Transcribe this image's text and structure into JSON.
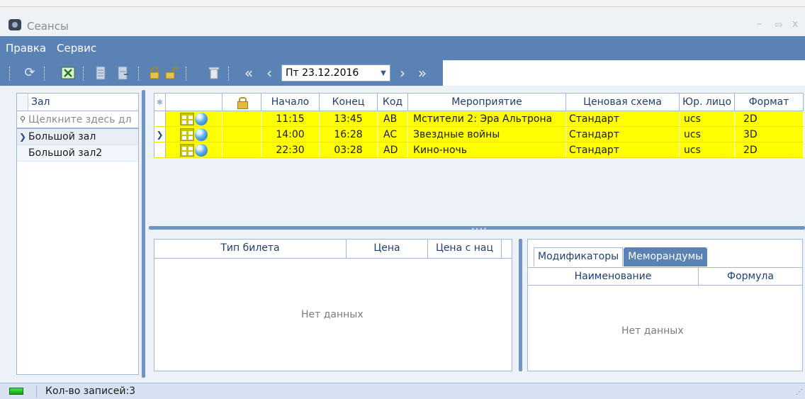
{
  "window": {
    "title": "Сеансы"
  },
  "menu": {
    "items": [
      "Правка",
      "Сервис"
    ]
  },
  "toolbar": {
    "date_value": "Пт 23.12.2016"
  },
  "halls": {
    "header": "Зал",
    "filter_placeholder": "Щелкните здесь дл",
    "rows": [
      {
        "label": "Большой зал",
        "selected": true
      },
      {
        "label": "Большой зал2",
        "selected": false
      }
    ]
  },
  "sessions": {
    "columns": [
      "",
      "",
      "",
      "Начало",
      "Конец",
      "Код",
      "Мероприятие",
      "Ценовая схема",
      "Юр. лицо",
      "Формат"
    ],
    "rows": [
      {
        "start": "11:15",
        "end": "13:45",
        "code": "AB",
        "event": "Мстители 2: Эра Альтрона",
        "price_scheme": "Стандарт",
        "entity": "ucs",
        "format": "2D",
        "current": false
      },
      {
        "start": "14:00",
        "end": "16:28",
        "code": "AC",
        "event": "Звездные войны",
        "price_scheme": "Стандарт",
        "entity": "ucs",
        "format": "3D",
        "current": true
      },
      {
        "start": "22:30",
        "end": "03:28",
        "code": "AD",
        "event": "Кино-ночь",
        "price_scheme": "Стандарт",
        "entity": "ucs",
        "format": "2D",
        "current": false
      }
    ],
    "row_color": "#ffff00"
  },
  "tickets": {
    "columns": [
      "Тип билета",
      "Цена",
      "Цена с нац"
    ],
    "empty_text": "Нет данных"
  },
  "modifiers": {
    "tabs": [
      "Модификаторы",
      "Меморандумы"
    ],
    "active_tab": 0,
    "columns": [
      "Наименование",
      "Формула"
    ],
    "empty_text": "Нет данных"
  },
  "status": {
    "records_text": "Кол-во записей:3"
  },
  "colors": {
    "accent": "#5a82b5",
    "border": "#a3b8d6",
    "header_text": "#1f3f73"
  }
}
